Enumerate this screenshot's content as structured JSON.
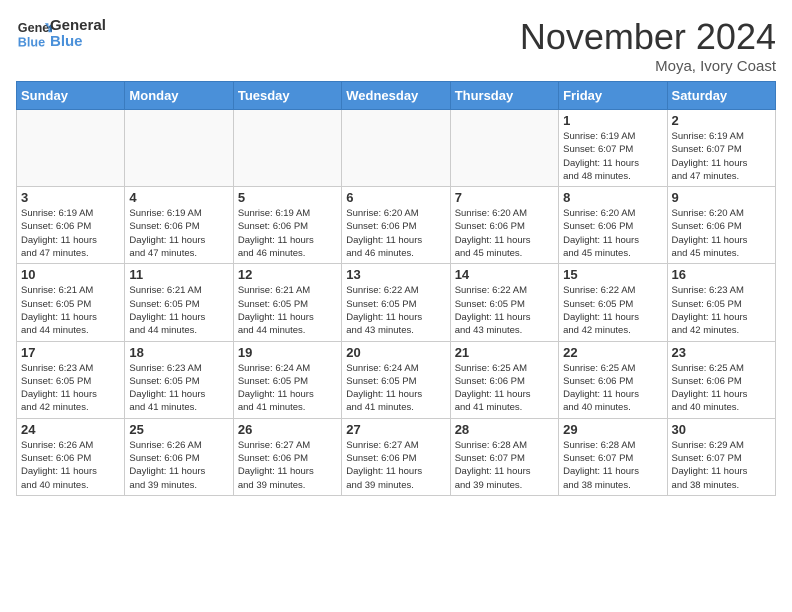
{
  "header": {
    "logo_line1": "General",
    "logo_line2": "Blue",
    "month": "November 2024",
    "location": "Moya, Ivory Coast"
  },
  "weekdays": [
    "Sunday",
    "Monday",
    "Tuesday",
    "Wednesday",
    "Thursday",
    "Friday",
    "Saturday"
  ],
  "weeks": [
    [
      {
        "day": "",
        "info": ""
      },
      {
        "day": "",
        "info": ""
      },
      {
        "day": "",
        "info": ""
      },
      {
        "day": "",
        "info": ""
      },
      {
        "day": "",
        "info": ""
      },
      {
        "day": "1",
        "info": "Sunrise: 6:19 AM\nSunset: 6:07 PM\nDaylight: 11 hours\nand 48 minutes."
      },
      {
        "day": "2",
        "info": "Sunrise: 6:19 AM\nSunset: 6:07 PM\nDaylight: 11 hours\nand 47 minutes."
      }
    ],
    [
      {
        "day": "3",
        "info": "Sunrise: 6:19 AM\nSunset: 6:06 PM\nDaylight: 11 hours\nand 47 minutes."
      },
      {
        "day": "4",
        "info": "Sunrise: 6:19 AM\nSunset: 6:06 PM\nDaylight: 11 hours\nand 47 minutes."
      },
      {
        "day": "5",
        "info": "Sunrise: 6:19 AM\nSunset: 6:06 PM\nDaylight: 11 hours\nand 46 minutes."
      },
      {
        "day": "6",
        "info": "Sunrise: 6:20 AM\nSunset: 6:06 PM\nDaylight: 11 hours\nand 46 minutes."
      },
      {
        "day": "7",
        "info": "Sunrise: 6:20 AM\nSunset: 6:06 PM\nDaylight: 11 hours\nand 45 minutes."
      },
      {
        "day": "8",
        "info": "Sunrise: 6:20 AM\nSunset: 6:06 PM\nDaylight: 11 hours\nand 45 minutes."
      },
      {
        "day": "9",
        "info": "Sunrise: 6:20 AM\nSunset: 6:06 PM\nDaylight: 11 hours\nand 45 minutes."
      }
    ],
    [
      {
        "day": "10",
        "info": "Sunrise: 6:21 AM\nSunset: 6:05 PM\nDaylight: 11 hours\nand 44 minutes."
      },
      {
        "day": "11",
        "info": "Sunrise: 6:21 AM\nSunset: 6:05 PM\nDaylight: 11 hours\nand 44 minutes."
      },
      {
        "day": "12",
        "info": "Sunrise: 6:21 AM\nSunset: 6:05 PM\nDaylight: 11 hours\nand 44 minutes."
      },
      {
        "day": "13",
        "info": "Sunrise: 6:22 AM\nSunset: 6:05 PM\nDaylight: 11 hours\nand 43 minutes."
      },
      {
        "day": "14",
        "info": "Sunrise: 6:22 AM\nSunset: 6:05 PM\nDaylight: 11 hours\nand 43 minutes."
      },
      {
        "day": "15",
        "info": "Sunrise: 6:22 AM\nSunset: 6:05 PM\nDaylight: 11 hours\nand 42 minutes."
      },
      {
        "day": "16",
        "info": "Sunrise: 6:23 AM\nSunset: 6:05 PM\nDaylight: 11 hours\nand 42 minutes."
      }
    ],
    [
      {
        "day": "17",
        "info": "Sunrise: 6:23 AM\nSunset: 6:05 PM\nDaylight: 11 hours\nand 42 minutes."
      },
      {
        "day": "18",
        "info": "Sunrise: 6:23 AM\nSunset: 6:05 PM\nDaylight: 11 hours\nand 41 minutes."
      },
      {
        "day": "19",
        "info": "Sunrise: 6:24 AM\nSunset: 6:05 PM\nDaylight: 11 hours\nand 41 minutes."
      },
      {
        "day": "20",
        "info": "Sunrise: 6:24 AM\nSunset: 6:05 PM\nDaylight: 11 hours\nand 41 minutes."
      },
      {
        "day": "21",
        "info": "Sunrise: 6:25 AM\nSunset: 6:06 PM\nDaylight: 11 hours\nand 41 minutes."
      },
      {
        "day": "22",
        "info": "Sunrise: 6:25 AM\nSunset: 6:06 PM\nDaylight: 11 hours\nand 40 minutes."
      },
      {
        "day": "23",
        "info": "Sunrise: 6:25 AM\nSunset: 6:06 PM\nDaylight: 11 hours\nand 40 minutes."
      }
    ],
    [
      {
        "day": "24",
        "info": "Sunrise: 6:26 AM\nSunset: 6:06 PM\nDaylight: 11 hours\nand 40 minutes."
      },
      {
        "day": "25",
        "info": "Sunrise: 6:26 AM\nSunset: 6:06 PM\nDaylight: 11 hours\nand 39 minutes."
      },
      {
        "day": "26",
        "info": "Sunrise: 6:27 AM\nSunset: 6:06 PM\nDaylight: 11 hours\nand 39 minutes."
      },
      {
        "day": "27",
        "info": "Sunrise: 6:27 AM\nSunset: 6:06 PM\nDaylight: 11 hours\nand 39 minutes."
      },
      {
        "day": "28",
        "info": "Sunrise: 6:28 AM\nSunset: 6:07 PM\nDaylight: 11 hours\nand 39 minutes."
      },
      {
        "day": "29",
        "info": "Sunrise: 6:28 AM\nSunset: 6:07 PM\nDaylight: 11 hours\nand 38 minutes."
      },
      {
        "day": "30",
        "info": "Sunrise: 6:29 AM\nSunset: 6:07 PM\nDaylight: 11 hours\nand 38 minutes."
      }
    ]
  ]
}
